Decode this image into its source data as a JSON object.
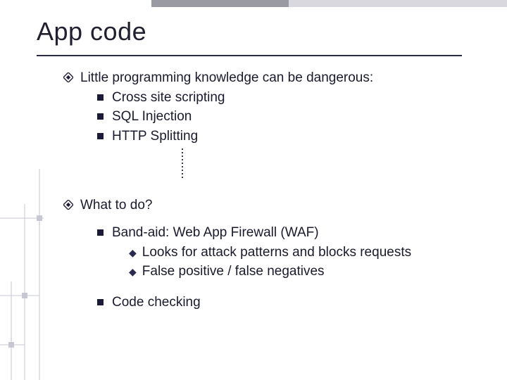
{
  "title": "App code",
  "bullets": [
    {
      "text": "Little programming knowledge can be dangerous:",
      "sub": [
        {
          "text": "Cross site scripting"
        },
        {
          "text": "SQL Injection"
        },
        {
          "text": "HTTP Splitting"
        }
      ]
    },
    {
      "text": "What to do?",
      "sub": [
        {
          "text": "Band-aid:   Web App Firewall  (WAF)",
          "subsub": [
            {
              "text": "Looks for attack patterns and blocks requests"
            },
            {
              "text": "False positive / false negatives"
            }
          ]
        },
        {
          "text": "Code checking"
        }
      ]
    }
  ]
}
